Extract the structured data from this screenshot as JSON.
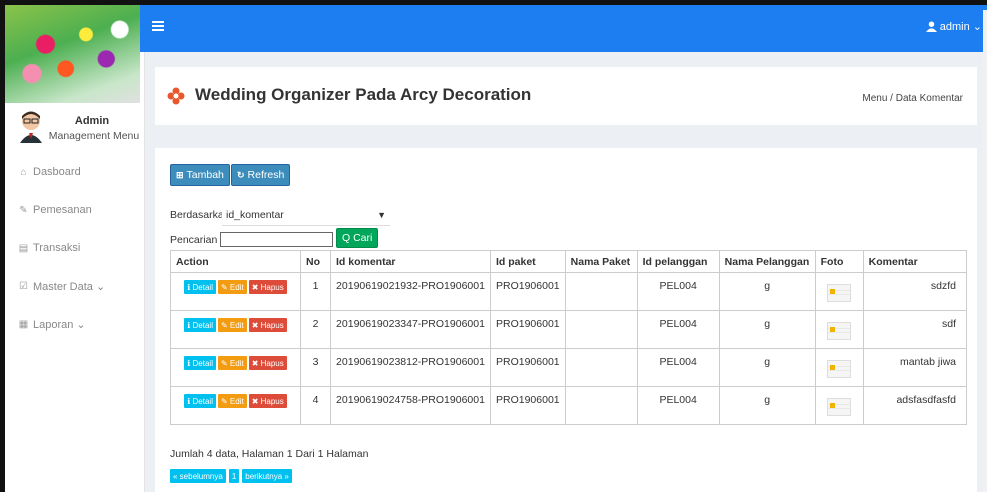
{
  "sidebar": {
    "user_name": "Admin",
    "user_role": "Management Menu",
    "items": [
      {
        "label": "Dasboard",
        "icon": "home-icon",
        "glyph": "⌂"
      },
      {
        "label": "Pemesanan",
        "icon": "pencil-icon",
        "glyph": "✎"
      },
      {
        "label": "Transaksi",
        "icon": "book-icon",
        "glyph": "▤"
      },
      {
        "label": "Master Data ⌄",
        "icon": "edit-icon",
        "glyph": "☑"
      },
      {
        "label": "Laporan ⌄",
        "icon": "calendar-icon",
        "glyph": "▦"
      }
    ]
  },
  "topbar": {
    "user_label": "admin ⌄",
    "color": "#1d7ef2"
  },
  "header": {
    "title": "Wedding Organizer Pada Arcy Decoration",
    "breadcrumb": "Menu / Data Komentar"
  },
  "toolbar": {
    "tambah": "Tambah",
    "refresh": "Refresh"
  },
  "filter": {
    "berdasarkan_label": "Berdasarkan:",
    "selected": "id_komentar",
    "pencarian_label": "Pencarian",
    "search_value": "",
    "cari": "Q Cari"
  },
  "table": {
    "headers": [
      "Action",
      "No",
      "Id komentar",
      "Id paket",
      "Nama Paket",
      "Id pelanggan",
      "Nama Pelanggan",
      "Foto",
      "Komentar"
    ],
    "action_labels": {
      "detail": "ℹ Detail",
      "edit": "✎ Edit",
      "hapus": "✖ Hapus"
    },
    "rows": [
      {
        "no": "1",
        "id_komentar": "20190619021932-PRO1906001",
        "id_paket": "PRO1906001",
        "nama_paket": "",
        "id_pelanggan": "PEL004",
        "nama_pelanggan": "g",
        "komentar": "sdzfd"
      },
      {
        "no": "2",
        "id_komentar": "20190619023347-PRO1906001",
        "id_paket": "PRO1906001",
        "nama_paket": "",
        "id_pelanggan": "PEL004",
        "nama_pelanggan": "g",
        "komentar": "sdf"
      },
      {
        "no": "3",
        "id_komentar": "20190619023812-PRO1906001",
        "id_paket": "PRO1906001",
        "nama_paket": "",
        "id_pelanggan": "PEL004",
        "nama_pelanggan": "g",
        "komentar": "mantab jiwa"
      },
      {
        "no": "4",
        "id_komentar": "20190619024758-PRO1906001",
        "id_paket": "PRO1906001",
        "nama_paket": "",
        "id_pelanggan": "PEL004",
        "nama_pelanggan": "g",
        "komentar": "adsfasdfasfd"
      }
    ]
  },
  "summary": "Jumlah 4 data, Halaman 1 Dari 1 Halaman",
  "pagination": {
    "prev": "« sebelumnya",
    "current": "1",
    "next": "berikutnya »"
  }
}
